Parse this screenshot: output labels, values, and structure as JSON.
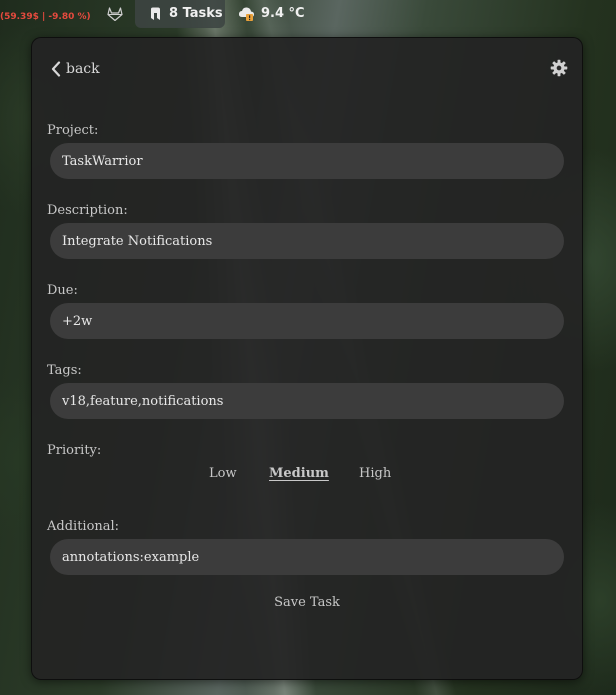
{
  "topbar": {
    "stock_text": "(59.39$ | -9.80 %)",
    "gitlab_icon": "gitlab-fox-icon",
    "tasks_label": "8 Tasks",
    "tasks_icon": "task-marker-icon",
    "temperature": "9.4 °C",
    "weather_icon": "cloud-alert-icon"
  },
  "nav": {
    "back_label": "back",
    "settings_icon": "gear-icon"
  },
  "form": {
    "project": {
      "label": "Project:",
      "value": "TaskWarrior"
    },
    "description": {
      "label": "Description:",
      "value": "Integrate Notifications"
    },
    "due": {
      "label": "Due:",
      "value": "+2w"
    },
    "tags": {
      "label": "Tags:",
      "value": "v18,feature,notifications"
    },
    "priority": {
      "label": "Priority:",
      "options": [
        "Low",
        "Medium",
        "High"
      ],
      "selected": "Medium"
    },
    "additional": {
      "label": "Additional:",
      "value": "annotations:example"
    },
    "save_label": "Save Task"
  },
  "colors": {
    "stock_negative": "#e44a3e",
    "panel_bg": "#242424",
    "input_bg": "#3c3c3c",
    "text": "#c8c8c8"
  }
}
